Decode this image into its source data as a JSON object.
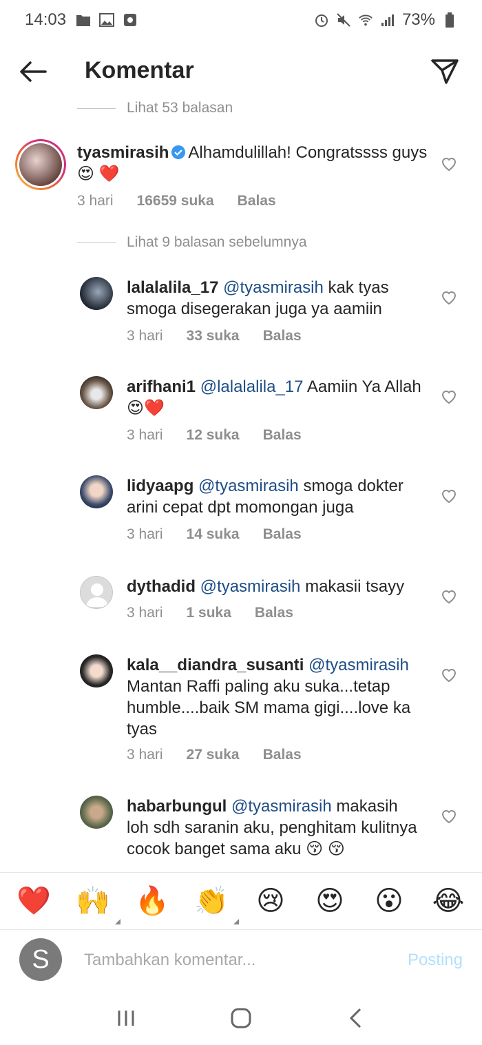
{
  "status_bar": {
    "time": "14:03",
    "battery": "73%"
  },
  "header": {
    "title": "Komentar"
  },
  "comments": {
    "top_view_replies": "Lihat 53 balasan",
    "main": {
      "username": "tyasmirasih",
      "text": "Alhamdulillah! Congratssss guys 😍 ❤️",
      "time": "3 hari",
      "likes": "16659 suka",
      "reply": "Balas"
    },
    "prev_replies": "Lihat 9 balasan sebelumnya",
    "replies": [
      {
        "username": "lalalalila_17",
        "mention": "@tyasmirasih",
        "text": "kak tyas smoga disegerakan juga ya aamiin",
        "time": "3 hari",
        "likes": "33 suka",
        "reply": "Balas"
      },
      {
        "username": "arifhani1",
        "mention": "@lalalalila_17",
        "text": "Aamiin Ya Allah😍❤️",
        "time": "3 hari",
        "likes": "12 suka",
        "reply": "Balas"
      },
      {
        "username": "lidyaapg",
        "mention": "@tyasmirasih",
        "text": "smoga dokter arini cepat dpt momongan juga",
        "time": "3 hari",
        "likes": "14 suka",
        "reply": "Balas"
      },
      {
        "username": "dythadid",
        "mention": "@tyasmirasih",
        "text": "makasii tsayy",
        "time": "3 hari",
        "likes": "1 suka",
        "reply": "Balas"
      },
      {
        "username": "kala__diandra_susanti",
        "mention": "@tyasmirasih",
        "text": "Mantan Raffi paling aku suka...tetap humble....baik SM mama gigi....love ka tyas",
        "time": "3 hari",
        "likes": "27 suka",
        "reply": "Balas"
      },
      {
        "username": "habarbungul",
        "mention": "@tyasmirasih",
        "text": "makasih loh sdh saranin aku, penghitam kulitnya cocok banget sama aku 😚 😚",
        "time": "",
        "likes": "",
        "reply": ""
      }
    ]
  },
  "emoji_bar": [
    "❤️",
    "🙌",
    "🔥",
    "👏",
    "😢",
    "😍",
    "😮",
    "😂"
  ],
  "composer": {
    "avatar_letter": "S",
    "placeholder": "Tambahkan komentar...",
    "post_label": "Posting"
  }
}
